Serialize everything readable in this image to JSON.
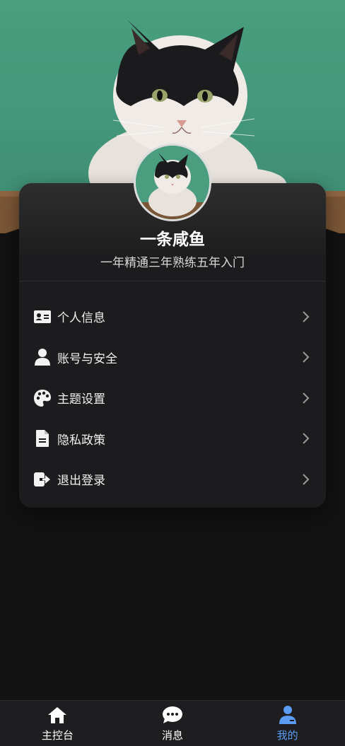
{
  "profile": {
    "name": "一条咸鱼",
    "motto": "一年精通三年熟练五年入门"
  },
  "menu": [
    {
      "label": "个人信息",
      "icon": "id-card-icon"
    },
    {
      "label": "账号与安全",
      "icon": "user-icon"
    },
    {
      "label": "主题设置",
      "icon": "palette-icon"
    },
    {
      "label": "隐私政策",
      "icon": "document-icon"
    },
    {
      "label": "退出登录",
      "icon": "logout-icon"
    }
  ],
  "tabs": [
    {
      "label": "主控台",
      "icon": "home-icon",
      "active": false
    },
    {
      "label": "消息",
      "icon": "chat-icon",
      "active": false
    },
    {
      "label": "我的",
      "icon": "user-profile-icon",
      "active": true
    }
  ],
  "colors": {
    "background": "#121212",
    "card": "#1c1c1e",
    "accent": "#5b9cf5",
    "hero_green": "#4a9e7f"
  }
}
